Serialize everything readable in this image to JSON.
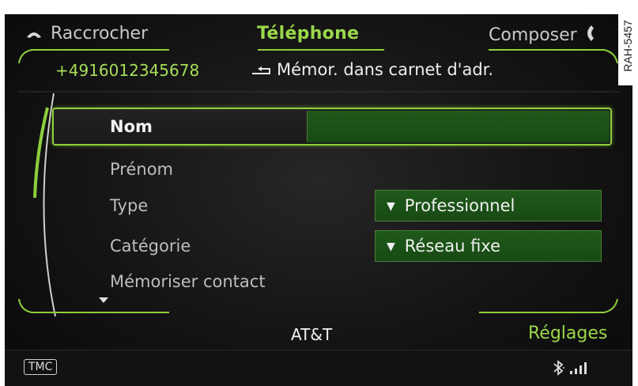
{
  "header": {
    "hangup_label": "Raccrocher",
    "title": "Téléphone",
    "dial_label": "Composer"
  },
  "contact_bar": {
    "number": "+4916012345678",
    "save_label": "Mémor. dans carnet d'adr."
  },
  "form": {
    "rows": [
      {
        "label": "Nom",
        "value": ""
      },
      {
        "label": "Prénom"
      },
      {
        "label": "Type",
        "value": "Professionnel"
      },
      {
        "label": "Catégorie",
        "value": "Réseau fixe"
      },
      {
        "label": "Mémoriser contact"
      }
    ]
  },
  "footer": {
    "provider": "AT&T",
    "settings_label": "Réglages"
  },
  "status_bar": {
    "tmc_label": "TMC",
    "bluetooth_icon": "bluetooth-icon",
    "signal_icon": "signal-strength-icon"
  },
  "reference_code": "RAH-5457",
  "colors": {
    "accent_green": "#9bd84a",
    "background": "#141414",
    "field_green": "#1f5a1a"
  }
}
